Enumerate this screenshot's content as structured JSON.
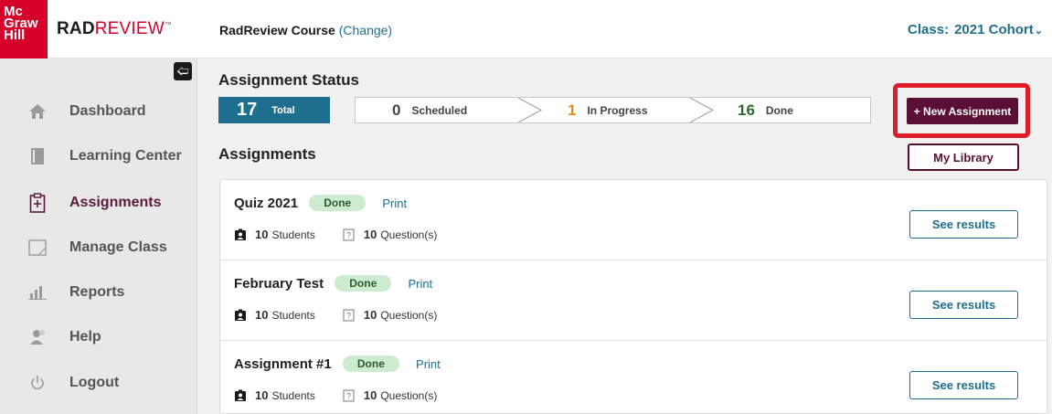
{
  "header": {
    "logo_lines": [
      "Mc",
      "Graw",
      "Hill"
    ],
    "product_bold": "RAD",
    "product_rest": "REVIEW",
    "product_tm": "™",
    "course_name": "RadReview Course",
    "course_change": "(Change)",
    "class_label": "Class:",
    "class_value": "2021 Cohort"
  },
  "sidebar": {
    "items": [
      {
        "label": "Dashboard",
        "icon": "home-icon"
      },
      {
        "label": "Learning Center",
        "icon": "book-icon"
      },
      {
        "label": "Assignments",
        "icon": "clipboard-icon",
        "active": true
      },
      {
        "label": "Manage Class",
        "icon": "window-icon"
      },
      {
        "label": "Reports",
        "icon": "bar-chart-icon"
      },
      {
        "label": "Help",
        "icon": "help-person-icon"
      },
      {
        "label": "Logout",
        "icon": "power-icon"
      }
    ]
  },
  "status": {
    "title": "Assignment Status",
    "total_count": "17",
    "total_label": "Total",
    "scheduled_count": "0",
    "scheduled_label": "Scheduled",
    "in_progress_count": "1",
    "in_progress_label": "In Progress",
    "done_count": "16",
    "done_label": "Done"
  },
  "actions": {
    "new_assignment": "+ New Assignment",
    "my_library": "My Library"
  },
  "assignments": {
    "title": "Assignments",
    "rows": [
      {
        "name": "Quiz 2021",
        "status": "Done",
        "print": "Print",
        "students": "10",
        "students_label": "Students",
        "questions": "10",
        "questions_label": "Question(s)",
        "action": "See results"
      },
      {
        "name": "February Test",
        "status": "Done",
        "print": "Print",
        "students": "10",
        "students_label": "Students",
        "questions": "10",
        "questions_label": "Question(s)",
        "action": "See results"
      },
      {
        "name": "Assignment #1",
        "status": "Done",
        "print": "Print",
        "students": "10",
        "students_label": "Students",
        "questions": "10",
        "questions_label": "Question(s)",
        "action": "See results"
      }
    ]
  },
  "colors": {
    "accent_teal": "#1e6f8f",
    "brand_maroon": "#5a0f35",
    "highlight_red": "#e01e2b",
    "in_progress_orange": "#e8891a",
    "done_green": "#2e6b2f"
  }
}
